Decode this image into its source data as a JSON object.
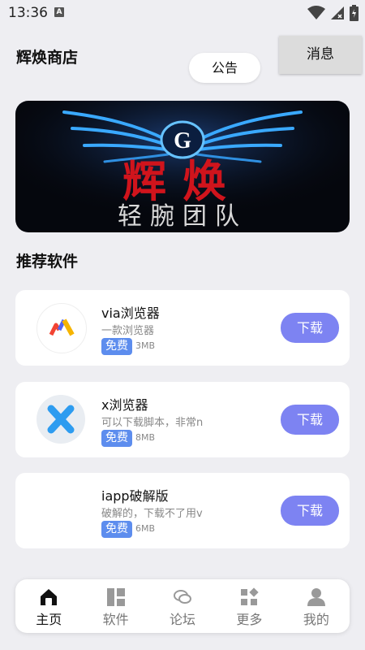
{
  "status": {
    "time": "13:36",
    "badge": "A"
  },
  "header": {
    "title": "辉焕商店",
    "notice": "公告",
    "messages": "消息"
  },
  "section_title": "推荐软件",
  "apps": [
    {
      "name": "via浏览器",
      "desc": "一款浏览器",
      "free": "免费",
      "size": "3MB",
      "download": "下载",
      "icon": "via-icon"
    },
    {
      "name": "x浏览器",
      "desc": "可以下载脚本，非常n",
      "free": "免费",
      "size": "8MB",
      "download": "下载",
      "icon": "x-browser-icon"
    },
    {
      "name": "iapp破解版",
      "desc": "破解的，下载不了用v",
      "free": "免费",
      "size": "6MB",
      "download": "下载",
      "icon": ""
    }
  ],
  "nav": [
    {
      "label": "主页",
      "icon": "home-icon",
      "active": true
    },
    {
      "label": "软件",
      "icon": "apps-icon",
      "active": false
    },
    {
      "label": "论坛",
      "icon": "chat-icon",
      "active": false
    },
    {
      "label": "更多",
      "icon": "more-icon",
      "active": false
    },
    {
      "label": "我的",
      "icon": "user-icon",
      "active": false
    }
  ],
  "colors": {
    "accent": "#7d83f2",
    "free_tag": "#5d8dee",
    "background": "#eeeef2"
  }
}
